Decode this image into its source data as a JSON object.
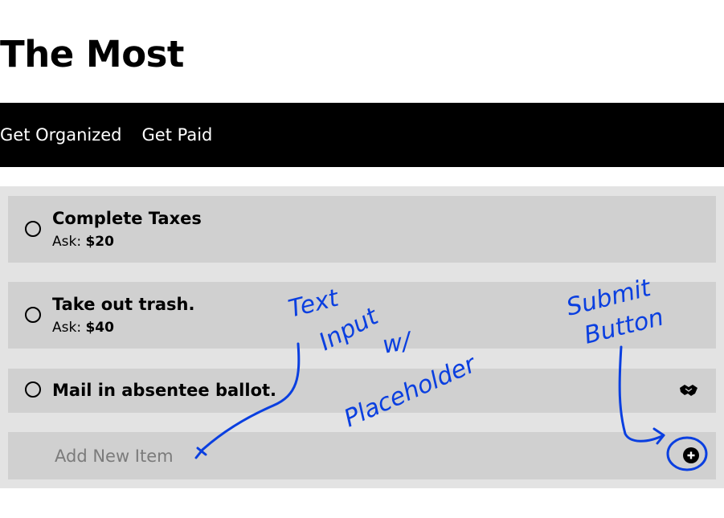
{
  "page": {
    "title": "The Most"
  },
  "nav": {
    "items": [
      {
        "label": "Get Organized"
      },
      {
        "label": "Get Paid"
      }
    ]
  },
  "todos": [
    {
      "title": "Complete Taxes",
      "ask_label": "Ask:",
      "ask_value": "$20"
    },
    {
      "title": "Take out trash.",
      "ask_label": "Ask:",
      "ask_value": "$40"
    },
    {
      "title": "Mail in absentee ballot.",
      "icon": "handshake-icon"
    }
  ],
  "add_item": {
    "placeholder": "Add New Item",
    "submit_icon": "plus-circle-icon"
  },
  "annotations": {
    "text_input_note": [
      "Text",
      "Input",
      "w/",
      "Placeholder"
    ],
    "submit_note": [
      "Submit",
      "Button"
    ],
    "color": "#0a3fe0"
  }
}
